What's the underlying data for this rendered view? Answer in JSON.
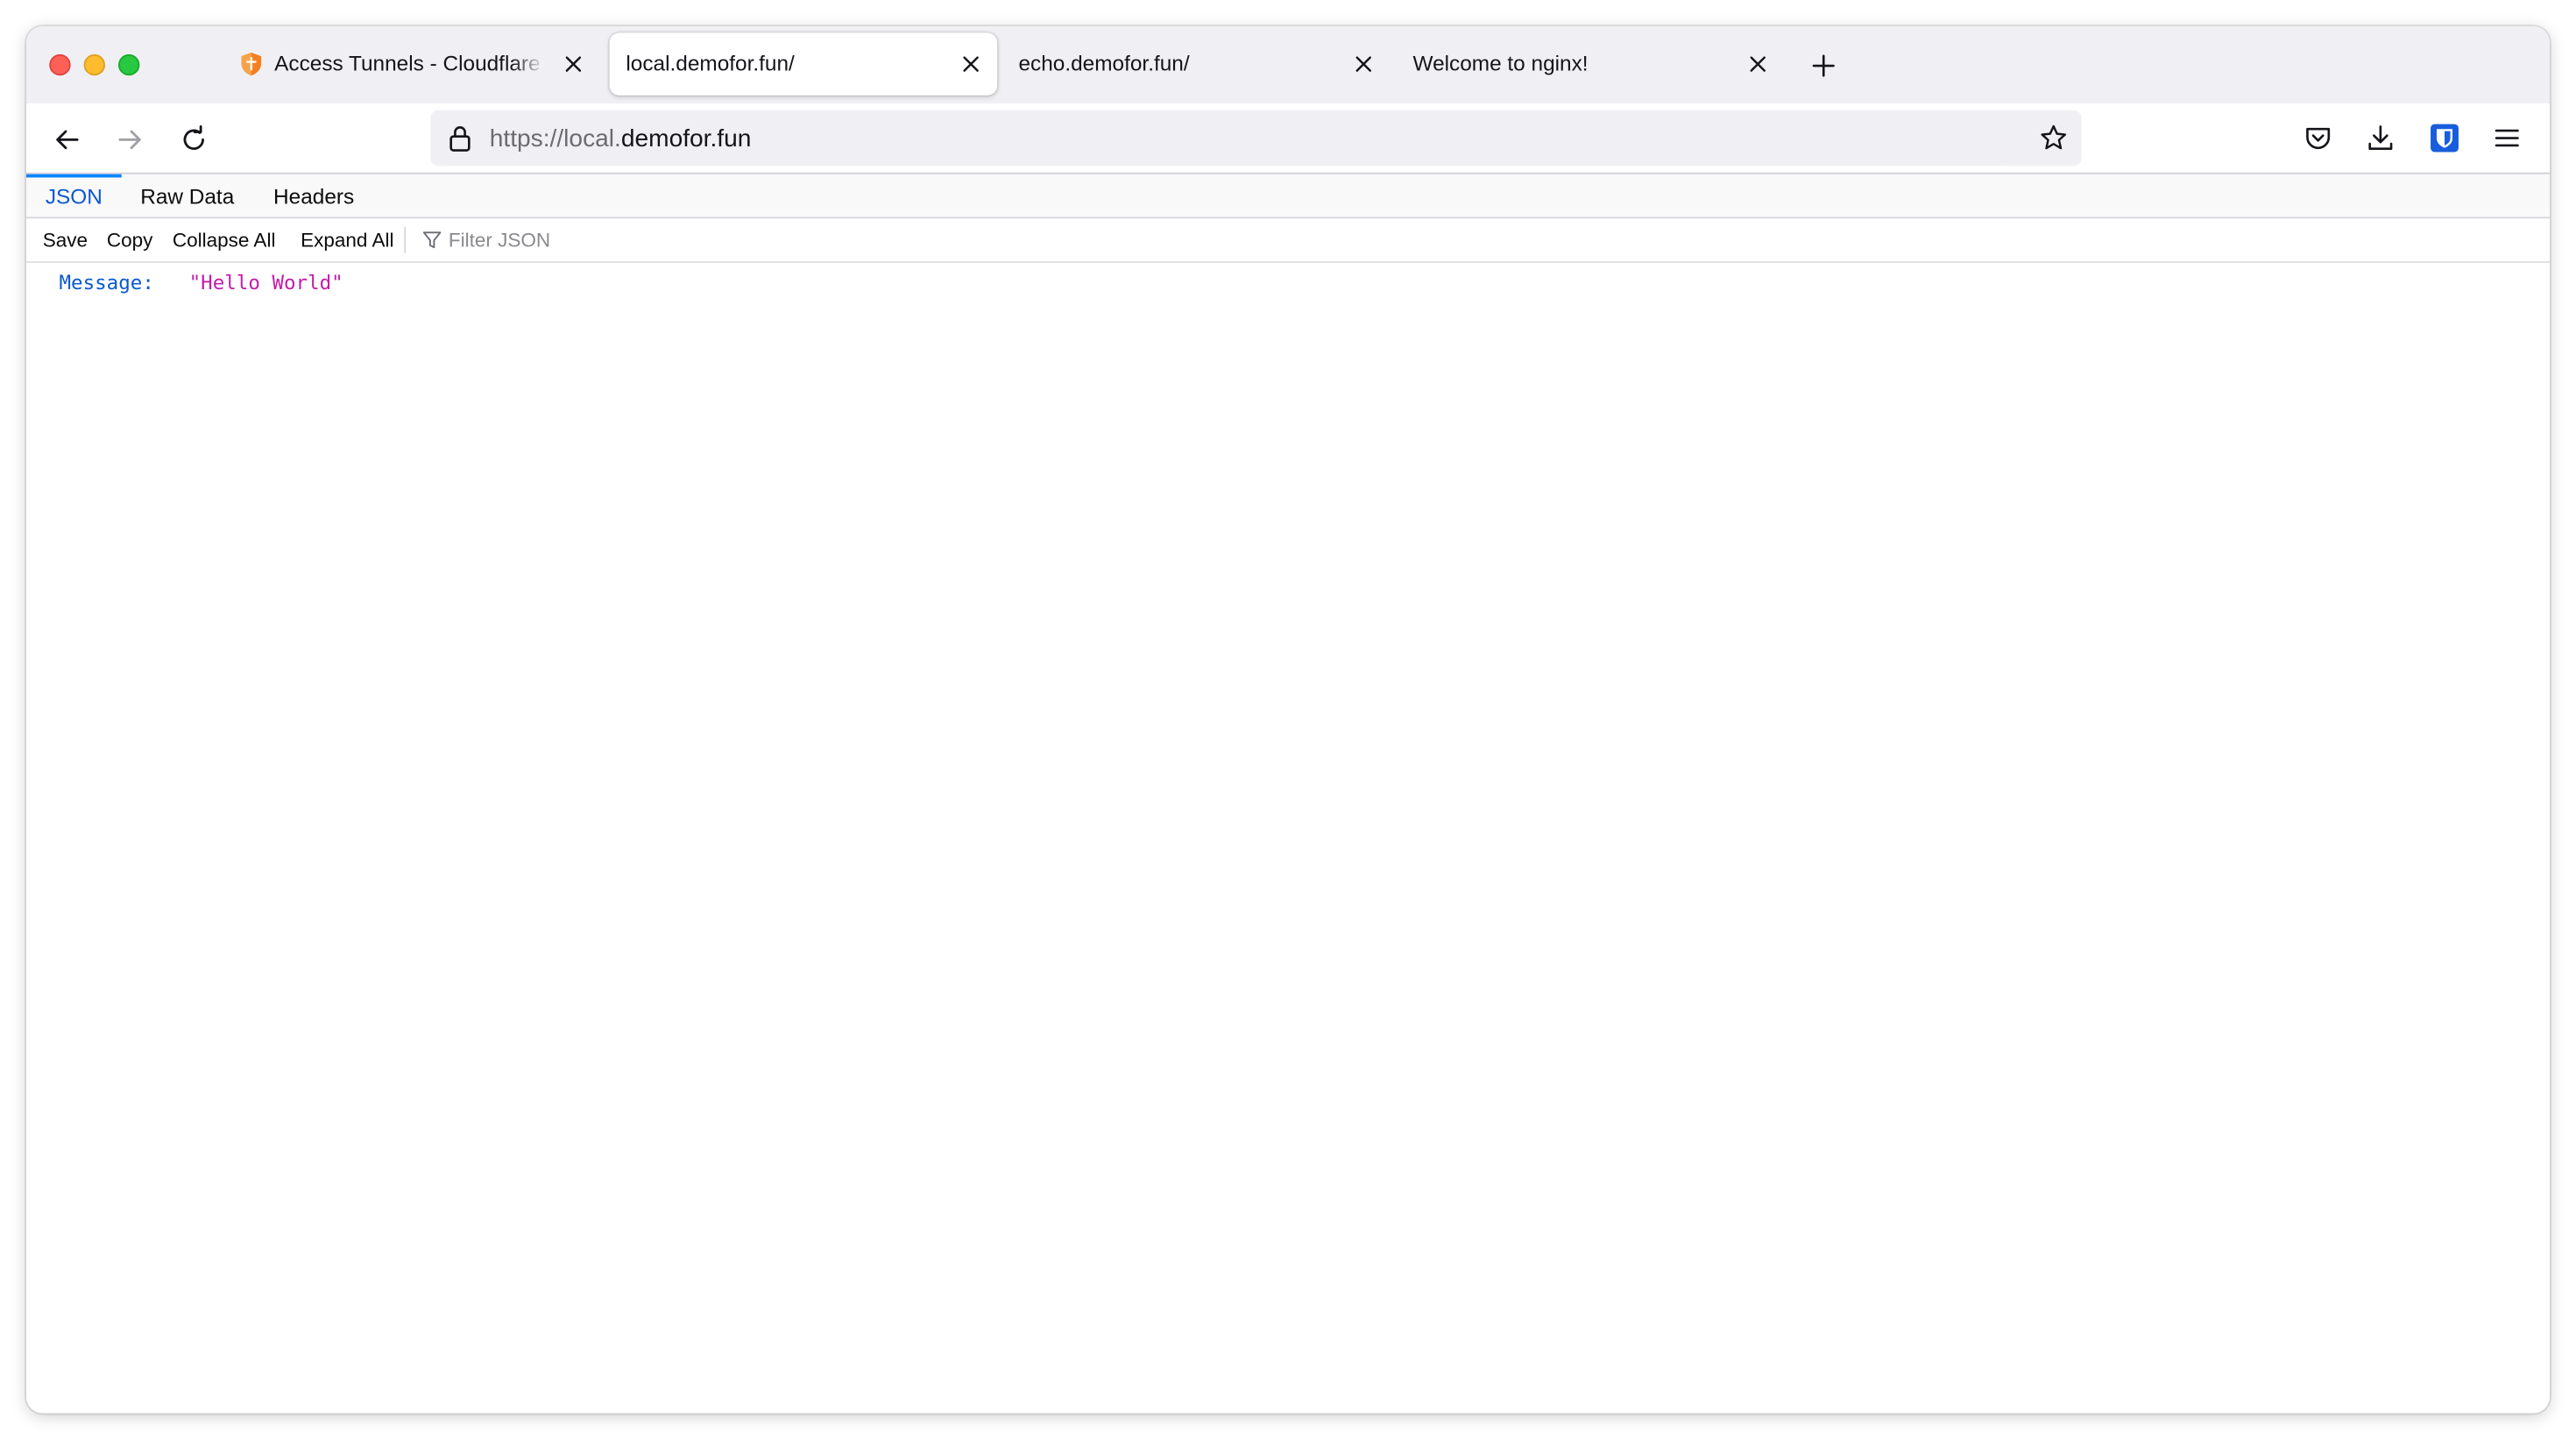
{
  "browser": {
    "tabs": [
      {
        "title": "Access Tunnels - Cloudflare Zero Trust",
        "icon": "cloudflare-shield-icon",
        "active": false
      },
      {
        "title": "local.demofor.fun/",
        "active": true
      },
      {
        "title": "echo.demofor.fun/",
        "active": false
      },
      {
        "title": "Welcome to nginx!",
        "active": false
      }
    ],
    "url": {
      "scheme": "https://",
      "subdomain": "local.",
      "domain": "demofor.fun"
    },
    "toolbar_icons": [
      "pocket-icon",
      "download-icon",
      "bitwarden-icon",
      "menu-icon"
    ]
  },
  "json_viewer": {
    "tabs": [
      "JSON",
      "Raw Data",
      "Headers"
    ],
    "selected_tab": "JSON",
    "toolbar": {
      "save": "Save",
      "copy": "Copy",
      "collapse_all": "Collapse All",
      "expand_all": "Expand All",
      "filter_placeholder": "Filter JSON"
    },
    "rows": [
      {
        "key": "Message:",
        "value": "\"Hello World\""
      }
    ]
  },
  "colors": {
    "accent": "#0a84ff",
    "json_key": "#0a59d0",
    "json_string": "#c51ca9",
    "bitwarden": "#175ddc",
    "cloudflare_orange": "#f38020"
  }
}
